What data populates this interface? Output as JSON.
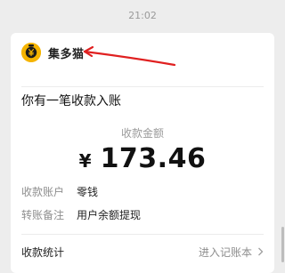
{
  "timestamp": "21:02",
  "message": {
    "app_name": "集多猫",
    "notice": "你有一笔收款入账",
    "amount_label": "收款金额",
    "currency": "¥",
    "amount": "173.46",
    "rows": [
      {
        "label": "收款账户",
        "value": "零钱"
      },
      {
        "label": "转账备注",
        "value": "用户余额提现"
      }
    ],
    "footer_left": "收款统计",
    "footer_right": "进入记账本"
  },
  "icons": {
    "logo": "gold-coin-yen-icon",
    "annotation": "red-arrow-icon",
    "chevron": "chevron-right-icon"
  },
  "colors": {
    "background": "#ededed",
    "card": "#ffffff",
    "logo": "#f5b400",
    "annotation": "#e02020"
  }
}
